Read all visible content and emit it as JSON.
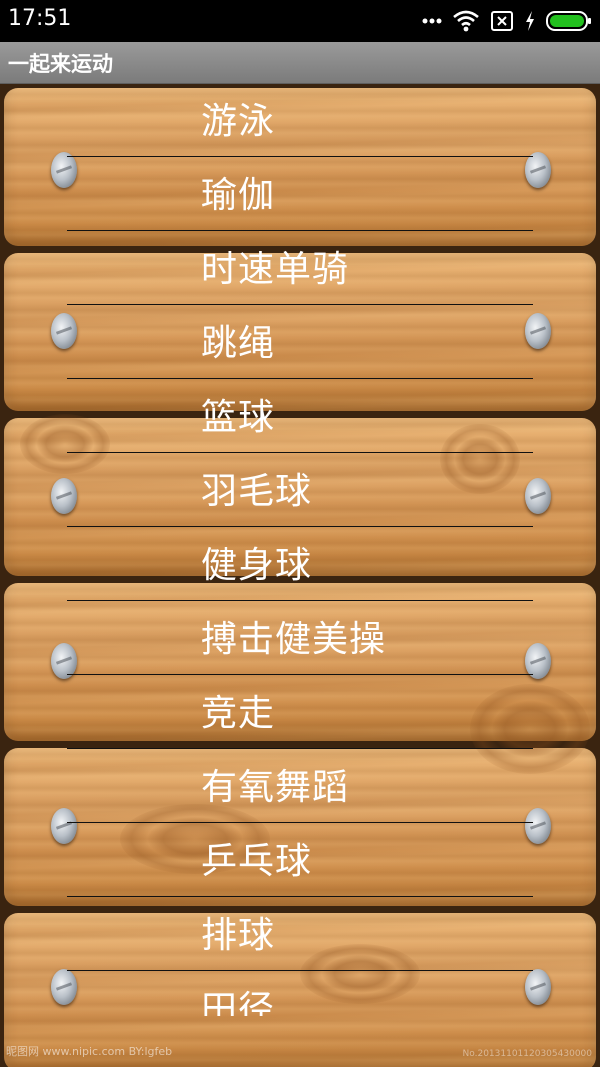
{
  "status_bar": {
    "time": "17:51",
    "icons": [
      "dots-icon",
      "wifi-icon",
      "sim-off-icon",
      "charging-bolt-icon",
      "battery-icon"
    ],
    "battery_color": "#22c01e"
  },
  "app": {
    "title": "一起来运动"
  },
  "sports": [
    {
      "label": "游泳"
    },
    {
      "label": "瑜伽"
    },
    {
      "label": "时速单骑"
    },
    {
      "label": "跳绳"
    },
    {
      "label": "篮球"
    },
    {
      "label": "羽毛球"
    },
    {
      "label": "健身球"
    },
    {
      "label": "搏击健美操"
    },
    {
      "label": "竞走"
    },
    {
      "label": "有氧舞蹈"
    },
    {
      "label": "乒乓球"
    },
    {
      "label": "排球"
    },
    {
      "label": "田径"
    }
  ],
  "watermark": {
    "left_text": "昵图网 www.nipic.com  BY:lgfeb",
    "right_text": "No.20131101120305430000"
  },
  "colors": {
    "status_bar_bg": "#000000",
    "title_bar_bg": "#8a8a8a",
    "wood": "#dca163",
    "item_text": "#ffffff",
    "separator": "#111111"
  }
}
